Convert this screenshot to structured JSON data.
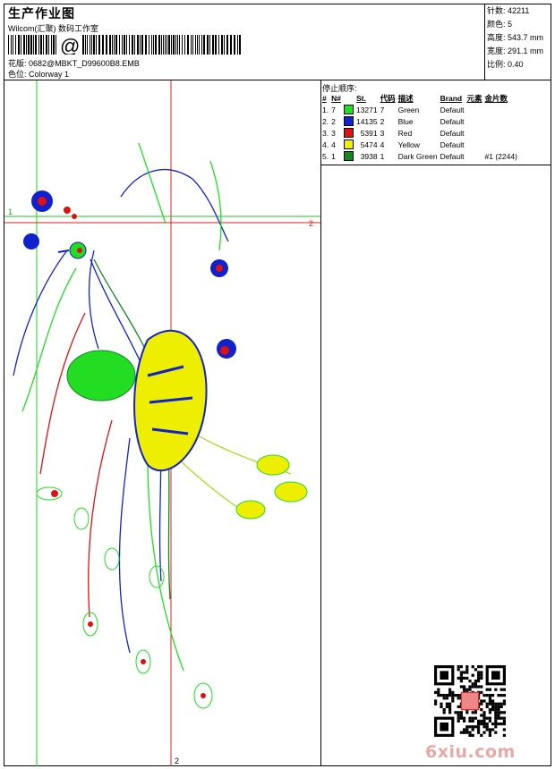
{
  "header": {
    "title": "生产作业图",
    "company": "Wilcom(汇聚) 数码工作室",
    "design_label": "花版:",
    "design_value": "0682@MBKT_D99600B8.EMB",
    "colorway_label": "色位:",
    "colorway_value": "Colorway 1"
  },
  "specs": {
    "stitches": "针数: 42211",
    "colors": "颜色: 5",
    "height": "高度: 543.7 mm",
    "width": "宽度: 291.1 mm",
    "scale": "比例: 0.40"
  },
  "stop_sequence": {
    "title": "停止顺序:",
    "columns": [
      "#",
      "N#",
      "St.",
      "代码",
      "描述",
      "Brand",
      "元素",
      "金片数"
    ],
    "rows": [
      {
        "num": "1.",
        "n": "7",
        "color": "#22dd22",
        "stitches": "13271",
        "code": "7",
        "desc": "Green",
        "brand": "Default",
        "extra": ""
      },
      {
        "num": "2.",
        "n": "2",
        "color": "#1122cc",
        "stitches": "14135",
        "code": "2",
        "desc": "Blue",
        "brand": "Default",
        "extra": ""
      },
      {
        "num": "3.",
        "n": "3",
        "color": "#dd1111",
        "stitches": "5391",
        "code": "3",
        "desc": "Red",
        "brand": "Default",
        "extra": ""
      },
      {
        "num": "4.",
        "n": "4",
        "color": "#eeee00",
        "stitches": "5474",
        "code": "4",
        "desc": "Yellow",
        "brand": "Default",
        "extra": ""
      },
      {
        "num": "5.",
        "n": "1",
        "color": "#118822",
        "stitches": "3938",
        "code": "1",
        "desc": "Dark Green",
        "brand": "Default",
        "extra": "#1 (2244)"
      }
    ]
  },
  "guides": {
    "left_marker": "1",
    "right_marker": "2",
    "bottom_marker": "2"
  },
  "watermark": "6xiu.com",
  "colors": {
    "guide_green": "#22cc22",
    "guide_red": "#dd2222"
  }
}
